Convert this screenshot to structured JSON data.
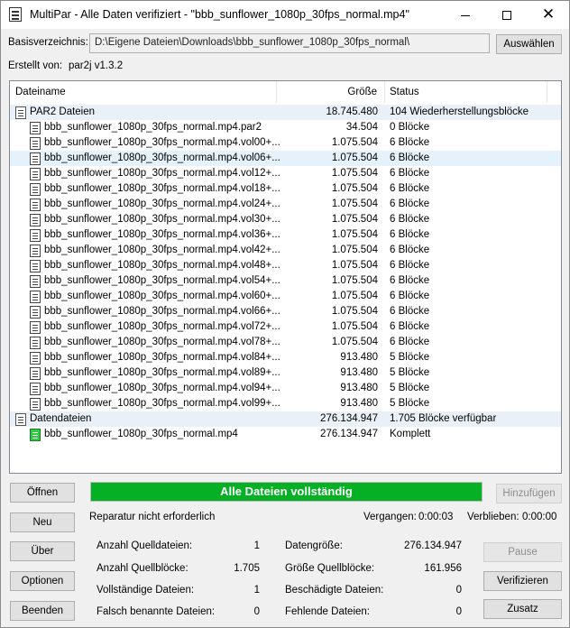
{
  "window": {
    "title": "MultiPar - Alle Daten verifiziert - \"bbb_sunflower_1080p_30fps_normal.mp4\"",
    "minimize": "",
    "maximize": "",
    "close": "✕"
  },
  "header": {
    "base_dir_label": "Basisverzeichnis:",
    "base_dir_value": "D:\\Eigene Dateien\\Downloads\\bbb_sunflower_1080p_30fps_normal\\",
    "choose_button": "Auswählen",
    "created_by_label": "Erstellt von:",
    "created_by_value": "par2j v1.3.2"
  },
  "list": {
    "columns": [
      "Dateiname",
      "Größe",
      "Status"
    ],
    "par2_group": {
      "name": "PAR2 Dateien",
      "size": "18.745.480",
      "status": "104 Wiederherstellungsblöcke"
    },
    "par2_files": [
      {
        "name": "bbb_sunflower_1080p_30fps_normal.mp4.par2",
        "size": "34.504",
        "status": "0 Blöcke"
      },
      {
        "name": "bbb_sunflower_1080p_30fps_normal.mp4.vol00+...",
        "size": "1.075.504",
        "status": "6 Blöcke"
      },
      {
        "name": "bbb_sunflower_1080p_30fps_normal.mp4.vol06+...",
        "size": "1.075.504",
        "status": "6 Blöcke"
      },
      {
        "name": "bbb_sunflower_1080p_30fps_normal.mp4.vol12+...",
        "size": "1.075.504",
        "status": "6 Blöcke"
      },
      {
        "name": "bbb_sunflower_1080p_30fps_normal.mp4.vol18+...",
        "size": "1.075.504",
        "status": "6 Blöcke"
      },
      {
        "name": "bbb_sunflower_1080p_30fps_normal.mp4.vol24+...",
        "size": "1.075.504",
        "status": "6 Blöcke"
      },
      {
        "name": "bbb_sunflower_1080p_30fps_normal.mp4.vol30+...",
        "size": "1.075.504",
        "status": "6 Blöcke"
      },
      {
        "name": "bbb_sunflower_1080p_30fps_normal.mp4.vol36+...",
        "size": "1.075.504",
        "status": "6 Blöcke"
      },
      {
        "name": "bbb_sunflower_1080p_30fps_normal.mp4.vol42+...",
        "size": "1.075.504",
        "status": "6 Blöcke"
      },
      {
        "name": "bbb_sunflower_1080p_30fps_normal.mp4.vol48+...",
        "size": "1.075.504",
        "status": "6 Blöcke"
      },
      {
        "name": "bbb_sunflower_1080p_30fps_normal.mp4.vol54+...",
        "size": "1.075.504",
        "status": "6 Blöcke"
      },
      {
        "name": "bbb_sunflower_1080p_30fps_normal.mp4.vol60+...",
        "size": "1.075.504",
        "status": "6 Blöcke"
      },
      {
        "name": "bbb_sunflower_1080p_30fps_normal.mp4.vol66+...",
        "size": "1.075.504",
        "status": "6 Blöcke"
      },
      {
        "name": "bbb_sunflower_1080p_30fps_normal.mp4.vol72+...",
        "size": "1.075.504",
        "status": "6 Blöcke"
      },
      {
        "name": "bbb_sunflower_1080p_30fps_normal.mp4.vol78+...",
        "size": "1.075.504",
        "status": "6 Blöcke"
      },
      {
        "name": "bbb_sunflower_1080p_30fps_normal.mp4.vol84+...",
        "size": "913.480",
        "status": "5 Blöcke"
      },
      {
        "name": "bbb_sunflower_1080p_30fps_normal.mp4.vol89+...",
        "size": "913.480",
        "status": "5 Blöcke"
      },
      {
        "name": "bbb_sunflower_1080p_30fps_normal.mp4.vol94+...",
        "size": "913.480",
        "status": "5 Blöcke"
      },
      {
        "name": "bbb_sunflower_1080p_30fps_normal.mp4.vol99+...",
        "size": "913.480",
        "status": "5 Blöcke"
      }
    ],
    "data_group": {
      "name": "Datendateien",
      "size": "276.134.947",
      "status": "1.705 Blöcke verfügbar"
    },
    "data_files": [
      {
        "name": "bbb_sunflower_1080p_30fps_normal.mp4",
        "size": "276.134.947",
        "status": "Komplett"
      }
    ]
  },
  "actions": {
    "open": "Öffnen",
    "new": "Neu",
    "about": "Über",
    "options": "Optionen",
    "exit": "Beenden",
    "add": "Hinzufügen",
    "pause": "Pause",
    "verify": "Verifizieren",
    "extra": "Zusatz"
  },
  "status": {
    "banner": "Alle Dateien vollständig",
    "banner_color": "#06b025",
    "message": "Reparatur nicht erforderlich",
    "elapsed_label": "Vergangen:",
    "elapsed_value": "0:00:03",
    "remaining_label": "Verblieben:",
    "remaining_value": "0:00:00"
  },
  "stats": {
    "left": [
      {
        "label": "Anzahl Quelldateien:",
        "value": "1"
      },
      {
        "label": "Anzahl Quellblöcke:",
        "value": "1.705"
      },
      {
        "label": "Vollständige Dateien:",
        "value": "1"
      },
      {
        "label": "Falsch benannte Dateien:",
        "value": "0"
      }
    ],
    "right": [
      {
        "label": "Datengröße:",
        "value": "276.134.947"
      },
      {
        "label": "Größe Quellblöcke:",
        "value": "161.956"
      },
      {
        "label": "Beschädigte Dateien:",
        "value": "0"
      },
      {
        "label": "Fehlende Dateien:",
        "value": "0"
      }
    ]
  }
}
